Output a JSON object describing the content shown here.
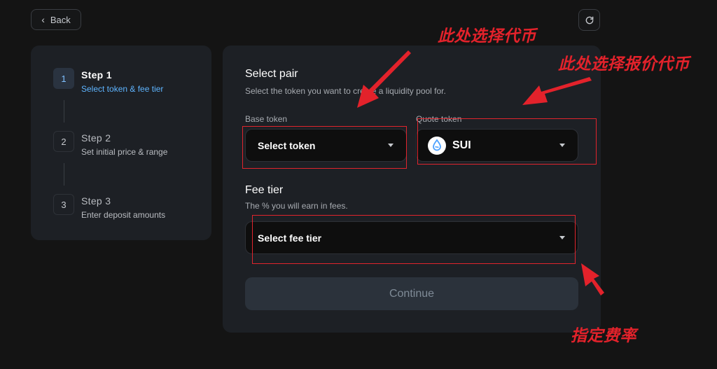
{
  "header": {
    "back_label": "Back"
  },
  "steps": [
    {
      "num": "1",
      "title": "Step  1",
      "sub": "Select token & fee tier",
      "active": true
    },
    {
      "num": "2",
      "title": "Step  2",
      "sub": "Set initial price & range",
      "active": false
    },
    {
      "num": "3",
      "title": "Step  3",
      "sub": "Enter deposit amounts",
      "active": false
    }
  ],
  "select_pair": {
    "title": "Select pair",
    "subtitle": "Select the token you want to create a liquidity pool for.",
    "base_label": "Base token",
    "base_value": "Select token",
    "quote_label": "Quote token",
    "quote_value": "SUI"
  },
  "fee": {
    "title": "Fee tier",
    "subtitle": "The % you will earn in fees.",
    "value": "Select fee tier"
  },
  "continue_label": "Continue",
  "annotations": {
    "base": "此处选择代币",
    "quote": "此处选择报价代币",
    "fee": "指定费率"
  },
  "colors": {
    "accent": "#5eb4ff",
    "annotation": "#e3222b",
    "background": "#141414",
    "card": "#1d2025"
  }
}
